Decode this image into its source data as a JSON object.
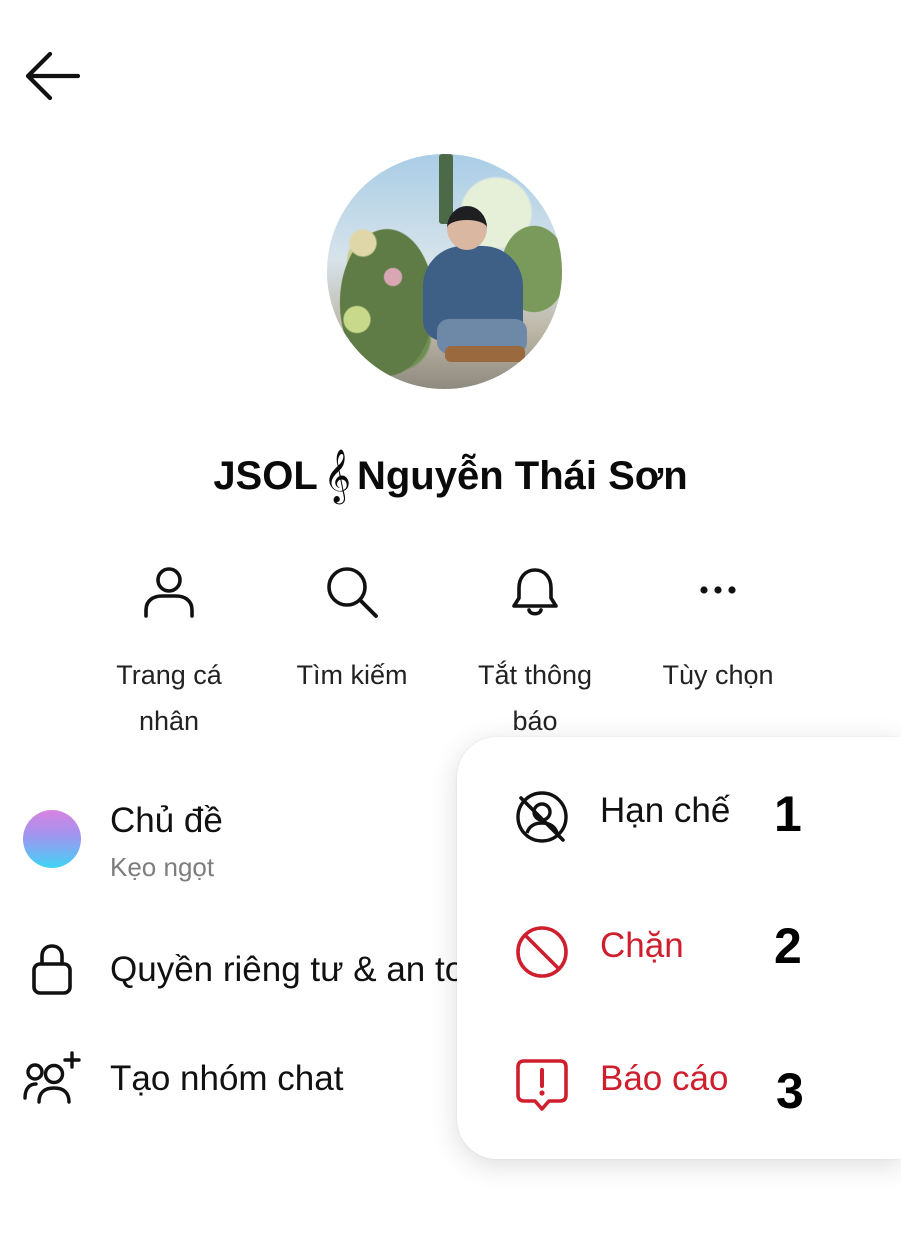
{
  "profile": {
    "name_prefix": "JSOL",
    "name_symbol": "𝄞",
    "name_suffix": "Nguyễn Thái Sơn"
  },
  "actions": [
    {
      "label_line1": "Trang cá",
      "label_line2": "nhân",
      "icon": "person-icon"
    },
    {
      "label_line1": "Tìm kiếm",
      "label_line2": "",
      "icon": "search-icon"
    },
    {
      "label_line1": "Tắt thông",
      "label_line2": "báo",
      "icon": "bell-icon"
    },
    {
      "label_line1": "Tùy chọn",
      "label_line2": "",
      "icon": "more-icon"
    }
  ],
  "settings": {
    "theme_label": "Chủ đề",
    "theme_value": "Kẹo ngọt",
    "privacy_label": "Quyền riêng tư & an toàn",
    "group_label": "Tạo nhóm chat"
  },
  "menu": {
    "items": [
      {
        "label": "Hạn chế",
        "icon": "restrict-icon",
        "color": "#111111",
        "annotation": "1"
      },
      {
        "label": "Chặn",
        "icon": "block-icon",
        "color": "#cf1f2e",
        "annotation": "2"
      },
      {
        "label": "Báo cáo",
        "icon": "report-icon",
        "color": "#cf1f2e",
        "annotation": "3"
      }
    ]
  },
  "colors": {
    "danger": "#cf1f2e",
    "text": "#111111",
    "secondary_text": "#7d7d7d"
  }
}
